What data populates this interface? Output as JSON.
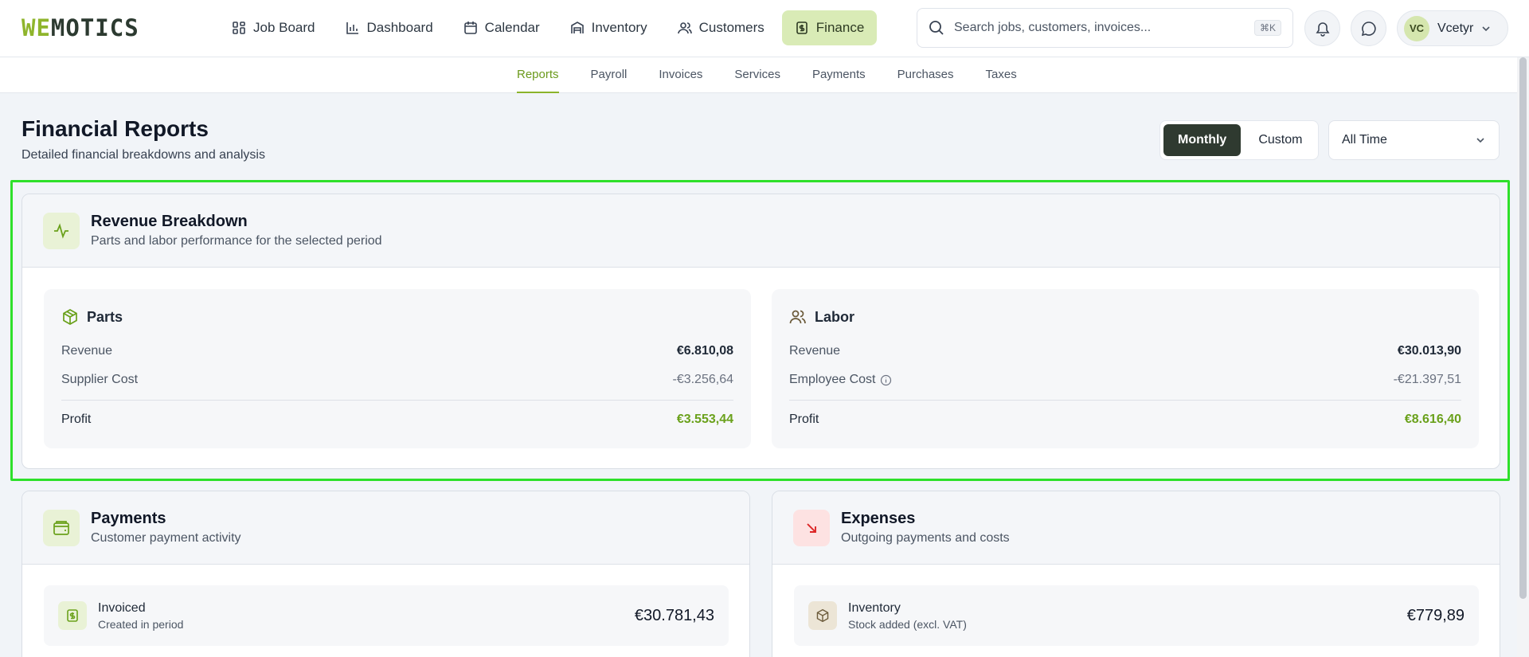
{
  "logo": {
    "part1": "WE",
    "part2": "MOTICS"
  },
  "nav": [
    {
      "label": "Job Board",
      "icon": "grid-icon"
    },
    {
      "label": "Dashboard",
      "icon": "bar-chart-icon"
    },
    {
      "label": "Calendar",
      "icon": "calendar-icon"
    },
    {
      "label": "Inventory",
      "icon": "warehouse-icon"
    },
    {
      "label": "Customers",
      "icon": "users-icon"
    },
    {
      "label": "Finance",
      "icon": "receipt-icon",
      "active": true
    }
  ],
  "search": {
    "placeholder": "Search jobs, customers, invoices...",
    "shortcut": "⌘K"
  },
  "user": {
    "initials": "VC",
    "name": "Vcetyr"
  },
  "subnav": [
    "Reports",
    "Payroll",
    "Invoices",
    "Services",
    "Payments",
    "Purchases",
    "Taxes"
  ],
  "page": {
    "title": "Financial Reports",
    "subtitle": "Detailed financial breakdowns and analysis"
  },
  "toggle": {
    "monthly": "Monthly",
    "custom": "Custom"
  },
  "period_select": {
    "value": "All Time"
  },
  "revenue": {
    "title": "Revenue Breakdown",
    "subtitle": "Parts and labor performance for the selected period",
    "parts": {
      "title": "Parts",
      "revenue_label": "Revenue",
      "revenue": "€6.810,08",
      "cost_label": "Supplier Cost",
      "cost": "-€3.256,64",
      "profit_label": "Profit",
      "profit": "€3.553,44"
    },
    "labor": {
      "title": "Labor",
      "revenue_label": "Revenue",
      "revenue": "€30.013,90",
      "cost_label": "Employee Cost",
      "cost": "-€21.397,51",
      "profit_label": "Profit",
      "profit": "€8.616,40"
    }
  },
  "payments": {
    "title": "Payments",
    "subtitle": "Customer payment activity",
    "invoiced": {
      "label": "Invoiced",
      "sub": "Created in period",
      "value": "€30.781,43"
    }
  },
  "expenses": {
    "title": "Expenses",
    "subtitle": "Outgoing payments and costs",
    "inventory": {
      "label": "Inventory",
      "sub": "Stock added (excl. VAT)",
      "value": "€779,89"
    }
  },
  "colors": {
    "accent": "#8bb32b",
    "profit": "#6aa11b",
    "highlight": "#2ee02a"
  }
}
